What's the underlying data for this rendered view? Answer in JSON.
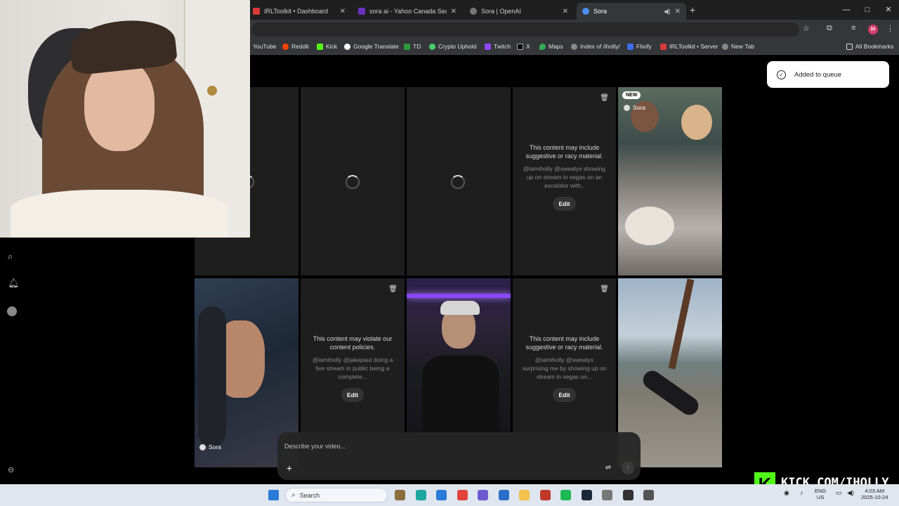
{
  "browser": {
    "tabs": [
      {
        "label": "IRLToolkit • Dashboard",
        "color": "#d83a3a",
        "active": false
      },
      {
        "label": "sora ai - Yahoo Canada Search",
        "color": "#6b2fbf",
        "active": false
      },
      {
        "label": "Sora | OpenAI",
        "color": "#777777",
        "active": false
      },
      {
        "label": "Sora",
        "color": "#4a8ef0",
        "active": true
      }
    ],
    "new_tab_symbol": "+",
    "window_controls": [
      "—",
      "□",
      "✕"
    ],
    "bookmarks": [
      {
        "label": "YouTube",
        "color": "#ff0000"
      },
      {
        "label": "Reddit",
        "color": "#ff4500"
      },
      {
        "label": "Kick",
        "color": "#53fc18"
      },
      {
        "label": "Google Translate",
        "color": "#4285f4"
      },
      {
        "label": "TD",
        "color": "#2c9a3a"
      },
      {
        "label": "Crypto Uphold",
        "color": "#49cc68"
      },
      {
        "label": "Twitch",
        "color": "#9146ff"
      },
      {
        "label": "X",
        "color": "#000000"
      },
      {
        "label": "Maps",
        "color": "#34a853"
      },
      {
        "label": "Index of /iholly/",
        "color": "#888888"
      },
      {
        "label": "Flixify",
        "color": "#3b6ee8"
      },
      {
        "label": "IRLToolkit • Server",
        "color": "#d83a3a"
      },
      {
        "label": "New Tab",
        "color": "#888888"
      }
    ],
    "all_bookmarks": "All Bookmarks",
    "profile_initial": "H"
  },
  "toast": {
    "text": "Added to queue"
  },
  "tiles": {
    "row1": {
      "t4": {
        "warning": "This content may include suggestive or racy material.",
        "prompt": "@iamiholly @sweatyv showing up on stream in vegas on an escalator with..",
        "edit": "Edit"
      },
      "t5": {
        "badge": "NEW",
        "source": "Sora"
      }
    },
    "row2": {
      "t1": {
        "source": "Sora"
      },
      "t2": {
        "warning": "This content may violate our content policies.",
        "prompt": "@iamiholly @jakepaul doing a live stream in public being a complete...",
        "edit": "Edit"
      },
      "t4": {
        "warning": "This content may include suggestive or racy material.",
        "prompt": "@iamiholly @sweatyv surprising me by showing up on stream in vegas on...",
        "edit": "Edit"
      }
    }
  },
  "composer": {
    "placeholder": "Describe your video..."
  },
  "kick": {
    "logo": "K",
    "text": "KICK.COM/IHOLLY"
  },
  "taskbar": {
    "search": "Search",
    "lang_top": "ENG",
    "lang_bottom": "US",
    "time": "4:03 AM",
    "date": "2025-10-24",
    "apps": [
      "#8a6e3c",
      "#1ea6a1",
      "#2b7bd8",
      "#e0443a",
      "#6b5bd1",
      "#2d6ec9",
      "#f2c14b",
      "#c0392b",
      "#1db954",
      "#1b2838",
      "#777777",
      "#333333",
      "#555555"
    ]
  }
}
